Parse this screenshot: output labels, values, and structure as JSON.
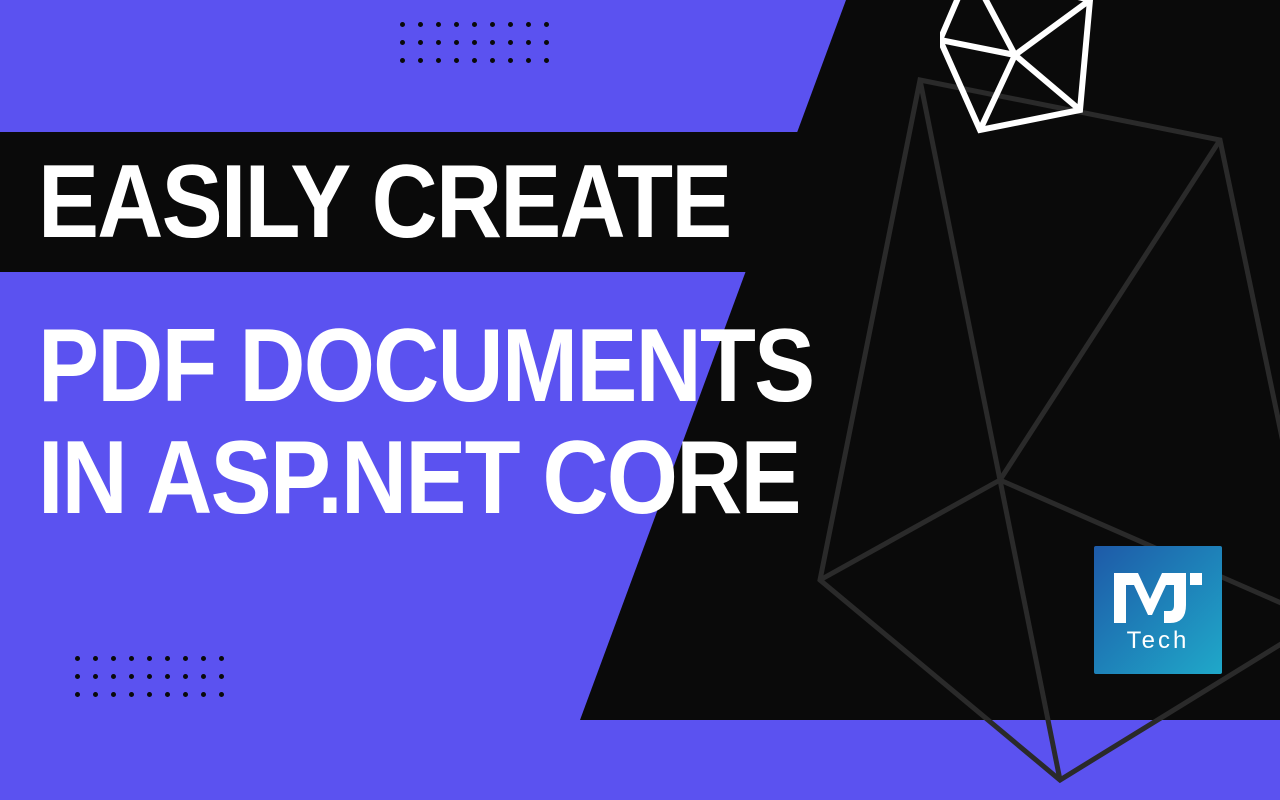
{
  "title": {
    "line1": "EASILY CREATE",
    "line2": "PDF DOCUMENTS",
    "line3": "IN ASP.NET CORE"
  },
  "logo": {
    "initials": "MJ",
    "subtext": "Tech"
  },
  "colors": {
    "bg_purple": "#5B52F0",
    "bg_black": "#0A0A0A",
    "text": "#FFFFFF",
    "logo_grad_a": "#1E5AA8",
    "logo_grad_b": "#1FA8C9"
  }
}
